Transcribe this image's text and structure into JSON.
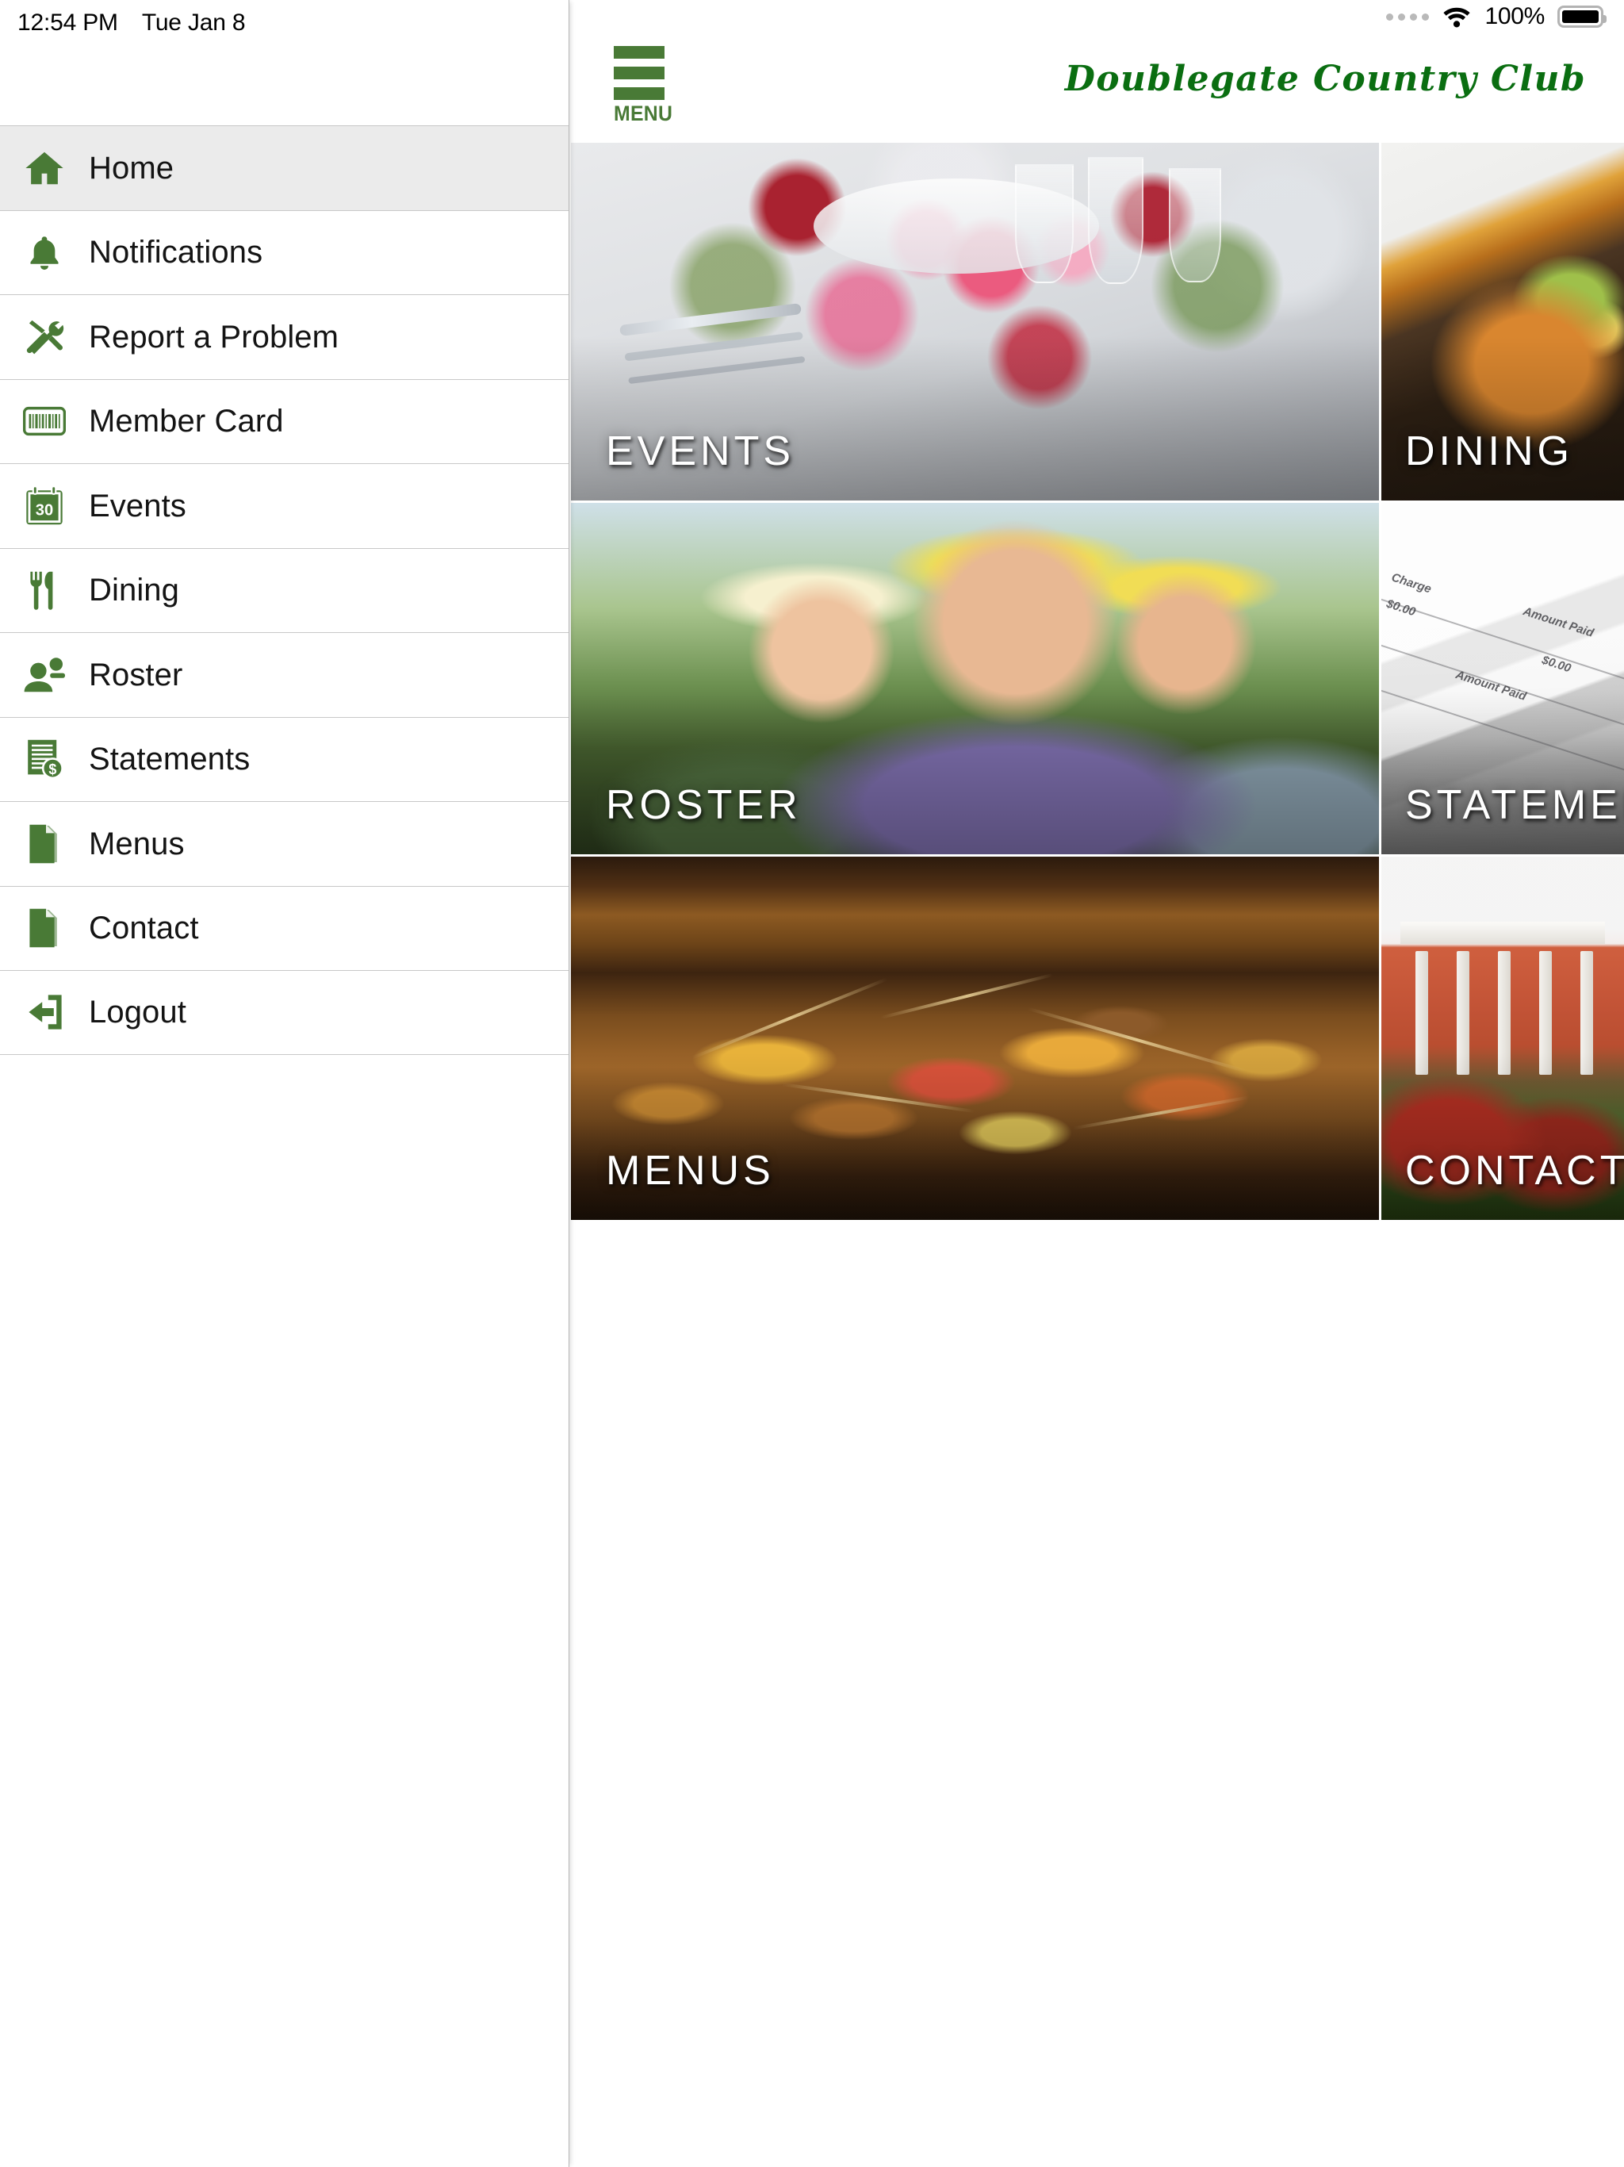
{
  "status_bar": {
    "time": "12:54 PM",
    "date": "Tue Jan 8",
    "battery_percent": "100%",
    "icons": [
      "signal-dots-icon",
      "wifi-icon",
      "battery-full-icon"
    ]
  },
  "header": {
    "menu_button_label": "MENU",
    "menu_icon": "hamburger-icon",
    "brand_title": "Doublegate Country Club",
    "brand_color": "#0a6e11"
  },
  "sidebar": {
    "accent_color": "#497a36",
    "active_background": "#ebebeb",
    "items": [
      {
        "label": "Home",
        "icon": "home-icon",
        "active": true
      },
      {
        "label": "Notifications",
        "icon": "bell-icon",
        "active": false
      },
      {
        "label": "Report a Problem",
        "icon": "tools-icon",
        "active": false
      },
      {
        "label": "Member Card",
        "icon": "barcode-card-icon",
        "active": false
      },
      {
        "label": "Events",
        "icon": "calendar-30-icon",
        "active": false
      },
      {
        "label": "Dining",
        "icon": "fork-knife-icon",
        "active": false
      },
      {
        "label": "Roster",
        "icon": "person-add-icon",
        "active": false
      },
      {
        "label": "Statements",
        "icon": "invoice-dollar-icon",
        "active": false
      },
      {
        "label": "Menus",
        "icon": "document-icon",
        "active": false
      },
      {
        "label": "Contact",
        "icon": "document-icon",
        "active": false
      },
      {
        "label": "Logout",
        "icon": "exit-icon",
        "active": false
      }
    ]
  },
  "tiles": [
    {
      "label": "EVENTS",
      "image": "banquet-table-with-flowers"
    },
    {
      "label": "DINING",
      "image": "plated-fish-entree"
    },
    {
      "label": "ROSTER",
      "image": "smiling-golfers-group"
    },
    {
      "label": "STATEMENTS",
      "image": "printed-invoices"
    },
    {
      "label": "MENUS",
      "image": "kebab-buffet-pan"
    },
    {
      "label": "CONTACT",
      "image": "clubhouse-exterior"
    }
  ],
  "statement_image_text": {
    "charge": "Charge",
    "amount_paid": "Amount Paid",
    "value_a": "$0.00",
    "value_b": "$0.00"
  }
}
